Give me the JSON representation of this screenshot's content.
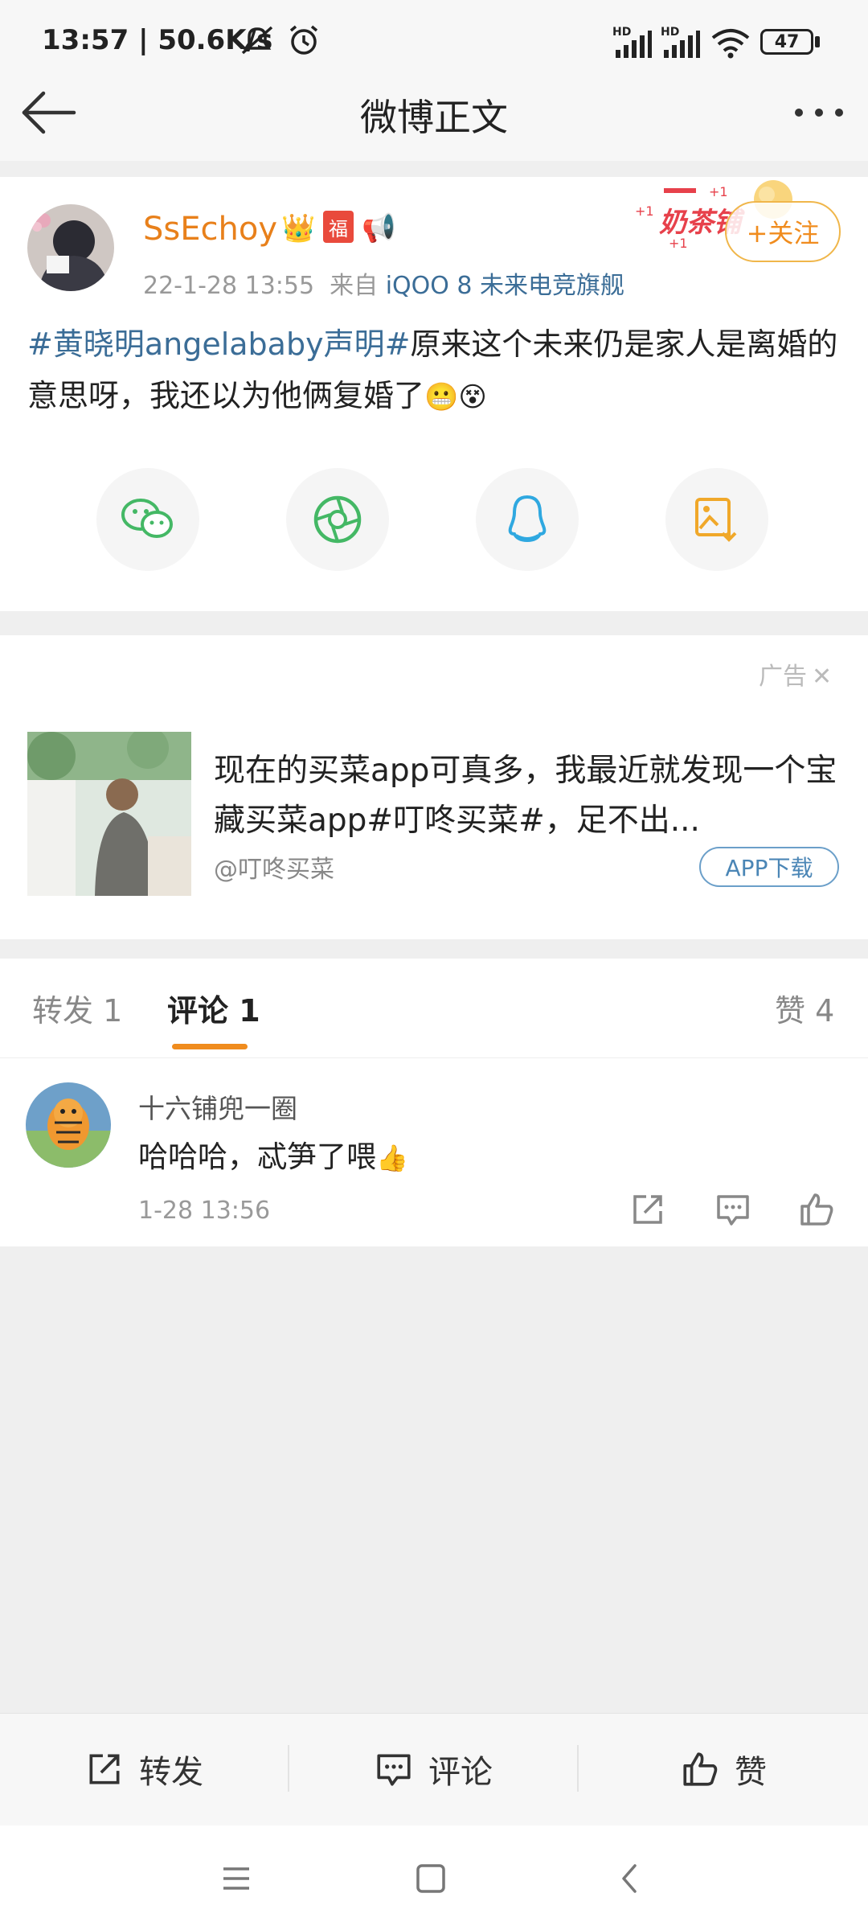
{
  "status_bar": {
    "time": "13:57",
    "speed": "50.6K/s",
    "hd1": "HD",
    "hd2": "HD",
    "battery": "47"
  },
  "nav": {
    "title": "微博正文",
    "back_icon": "arrow-left-icon",
    "more_icon": "more-dots-icon"
  },
  "post": {
    "username": "SsEchoy",
    "date": "22-1-28 13:55",
    "from_prefix": "来自",
    "source": "iQOO 8 未来电竞旗舰",
    "follow_label": "+关注",
    "topic": "#黄晓明angelababy声明#",
    "text": "原来这个未来仍是家人是离婚的意思呀，我还以为他俩复婚了",
    "share_icons": [
      "wechat-icon",
      "moments-icon",
      "qq-icon",
      "save-image-icon"
    ]
  },
  "ad": {
    "label": "广告",
    "text": "现在的买菜app可真多，我最近就发现一个宝藏买菜app#叮咚买菜#，足不出...",
    "source": "@叮咚买菜",
    "download_label": "APP下载"
  },
  "tabs": {
    "repost": "转发 1",
    "comments": "评论 1",
    "likes": "赞 4"
  },
  "comment": {
    "user": "十六铺兜一圈",
    "text": "哈哈哈，忒笋了喂",
    "time": "1-28 13:56"
  },
  "actions": {
    "repost": "转发",
    "comment": "评论",
    "like": "赞"
  },
  "colors": {
    "accent": "#f08c1e",
    "link": "#3b6d97",
    "username": "#e8801b"
  }
}
